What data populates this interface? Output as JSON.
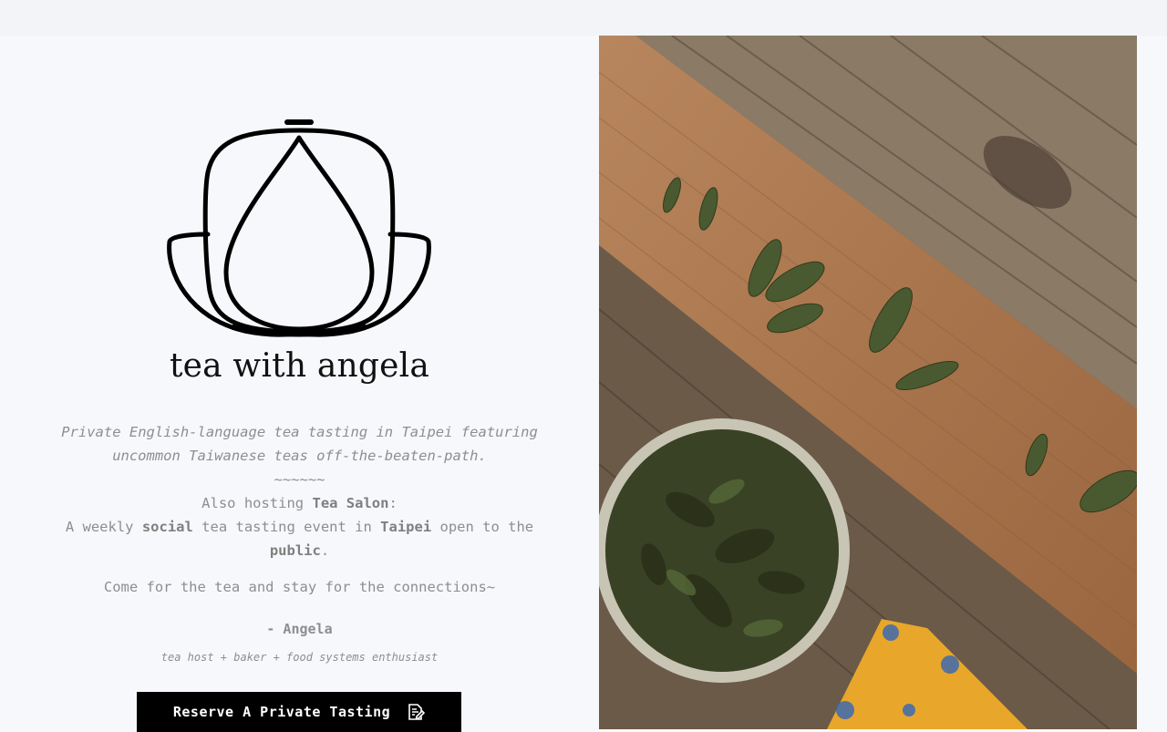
{
  "brand": {
    "name": "tea with angela",
    "logo_icon": "teapot-lotus-logo-icon"
  },
  "intro": {
    "line1": "Private English-language tea tasting in Taipei featuring uncommon Taiwanese teas off-the-beaten-path.",
    "divider": "~~~~~~",
    "also_prefix": "Also hosting ",
    "also_bold": "Tea Salon",
    "also_suffix": ":",
    "weekly_a": "A weekly ",
    "weekly_b": "social",
    "weekly_c": " tea tasting event in ",
    "weekly_d": "Taipei",
    "weekly_e": " open to the ",
    "weekly_f": "public",
    "weekly_g": "."
  },
  "tagline": "Come for the tea and stay for the connections~",
  "signature": "- Angela",
  "subtitle": "tea host + baker + food systems enthusiast",
  "cta": {
    "label": "Reserve A Private Tasting",
    "icon": "edit-note-icon"
  },
  "photo": {
    "subject": "tea-leaves-on-wood-photo"
  }
}
